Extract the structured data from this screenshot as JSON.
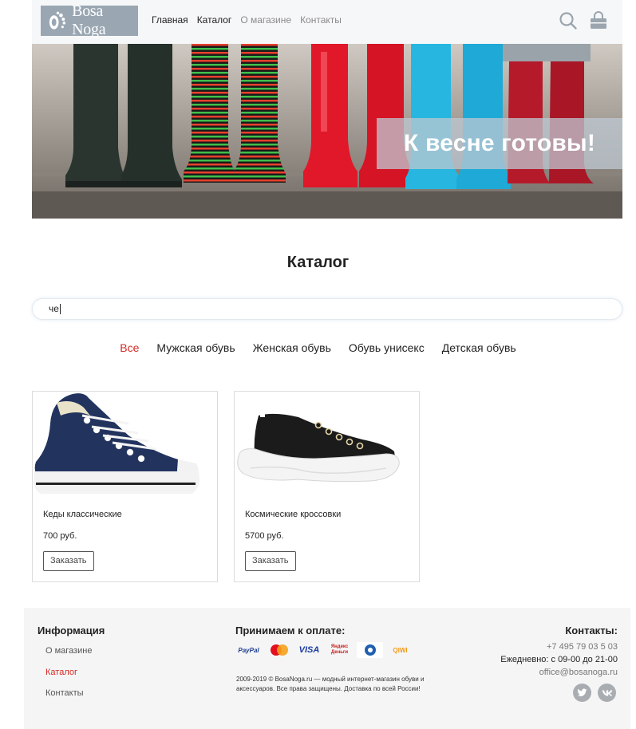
{
  "header": {
    "logo_text": "Bosa Noga",
    "nav": [
      {
        "label": "Главная",
        "active": true
      },
      {
        "label": "Каталог",
        "active": true
      },
      {
        "label": "О магазине",
        "active": false
      },
      {
        "label": "Контакты",
        "active": false
      }
    ],
    "icons": [
      "search-icon",
      "shopping-bag-icon"
    ]
  },
  "banner": {
    "caption": "К весне готовы!"
  },
  "catalog": {
    "title": "Каталог",
    "search_value": "че",
    "categories": [
      {
        "label": "Все",
        "active": true
      },
      {
        "label": "Мужская обувь",
        "active": false
      },
      {
        "label": "Женская обувь",
        "active": false
      },
      {
        "label": "Обувь унисекс",
        "active": false
      },
      {
        "label": "Детская обувь",
        "active": false
      }
    ],
    "products": [
      {
        "name": "Кеды классические",
        "price": "700 руб.",
        "button": "Заказать"
      },
      {
        "name": "Космические кроссовки",
        "price": "5700 руб.",
        "button": "Заказать"
      }
    ]
  },
  "footer": {
    "info_title": "Информация",
    "links": [
      {
        "label": "О магазине",
        "active": false
      },
      {
        "label": "Каталог",
        "active": true
      },
      {
        "label": "Контакты",
        "active": false
      }
    ],
    "payment_title": "Принимаем к оплате:",
    "payment_methods": [
      "PayPal",
      "MasterCard",
      "VISA",
      "Яндекс Деньги",
      "WebMoney",
      "QIWI"
    ],
    "copyright": "2009-2019 © BosaNoga.ru — модный интернет-магазин обуви и аксессуаров. Все права защищены. Доставка по всей России!",
    "contacts_title": "Контакты:",
    "phone": "+7 495 79 03 5 03",
    "hours": "Ежедневно: с 09-00 до 21-00",
    "email": "office@bosanoga.ru",
    "social": [
      "twitter-icon",
      "vk-icon"
    ]
  },
  "colors": {
    "accent": "#d42a25",
    "header_bg": "#f6f7f8",
    "logo_bg": "#9aa7b3",
    "footer_bg": "#f5f5f6"
  }
}
